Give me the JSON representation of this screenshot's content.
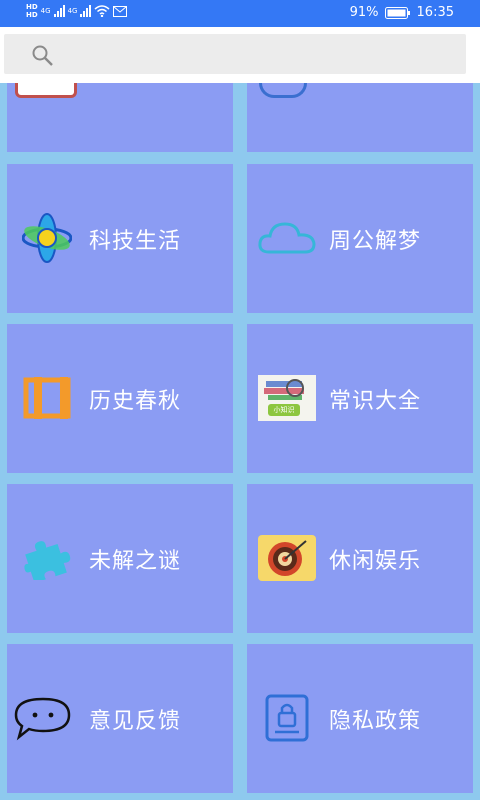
{
  "status": {
    "battery": "91%",
    "time": "16:35",
    "net1": "4G",
    "net2": "4G"
  },
  "search": {
    "placeholder": ""
  },
  "tiles": [
    {
      "label": "科技生活",
      "icon": "atom-icon"
    },
    {
      "label": "周公解梦",
      "icon": "cloud-icon"
    },
    {
      "label": "历史春秋",
      "icon": "scroll-icon"
    },
    {
      "label": "常识大全",
      "icon": "knowledge-book-icon",
      "badge": "小知识"
    },
    {
      "label": "未解之谜",
      "icon": "puzzle-icon"
    },
    {
      "label": "休闲娱乐",
      "icon": "dartboard-icon"
    },
    {
      "label": "意见反馈",
      "icon": "chat-bubble-icon"
    },
    {
      "label": "隐私政策",
      "icon": "lock-document-icon"
    }
  ],
  "colors": {
    "statusbar": "#3478f5",
    "tile": "#8b9cf3",
    "gap": "#8ec9ee"
  }
}
